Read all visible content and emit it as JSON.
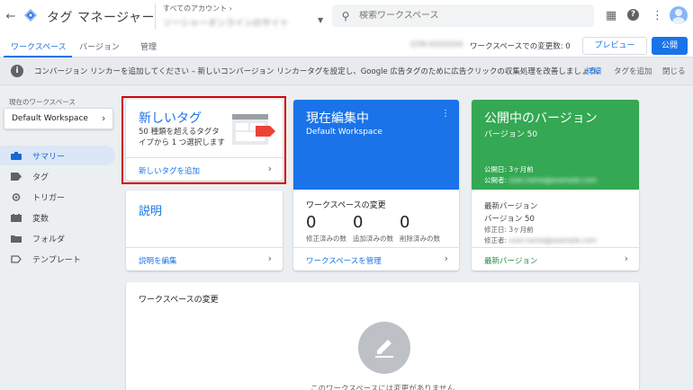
{
  "header": {
    "app_title": "タグ マネージャー",
    "account_label": "すべてのアカウント ›",
    "container_name": "ソーシャーオンラインのサイト",
    "search_placeholder": "検索ワークスペース"
  },
  "tabs": [
    {
      "label": "ワークスペース",
      "active": true
    },
    {
      "label": "バージョン",
      "active": false
    },
    {
      "label": "管理",
      "active": false
    }
  ],
  "toolbar": {
    "blurred_id": "GTM-XXXXXXX",
    "changes_text": "ワークスペースでの変更数: 0",
    "preview_label": "プレビュー",
    "publish_label": "公開"
  },
  "banner": {
    "text": "コンバージョン リンカーを追加してください – 新しいコンバージョン リンカータグを設定し、Google 広告タグのために広告クリックの収集処理を改善しましょう。",
    "link": "詳細",
    "add_tag": "タグを追加",
    "close": "閉じる"
  },
  "sidebar": {
    "workspace_label": "現在のワークスペース",
    "workspace_name": "Default Workspace",
    "items": [
      {
        "label": "サマリー",
        "active": true,
        "icon": "briefcase-icon"
      },
      {
        "label": "タグ",
        "active": false,
        "icon": "tag-icon"
      },
      {
        "label": "トリガー",
        "active": false,
        "icon": "trigger-icon"
      },
      {
        "label": "変数",
        "active": false,
        "icon": "variables-icon"
      },
      {
        "label": "フォルダ",
        "active": false,
        "icon": "folder-icon"
      },
      {
        "label": "テンプレート",
        "active": false,
        "icon": "template-icon"
      }
    ]
  },
  "new_tag": {
    "title": "新しいタグ",
    "description": "50 種類を超えるタグタイプから 1 つ選択します",
    "link": "新しいタグを追加"
  },
  "editing": {
    "title": "現在編集中",
    "workspace": "Default Workspace",
    "changes_title": "ワークスペースの変更",
    "counts": [
      {
        "value": "0",
        "label": "修正済みの数"
      },
      {
        "value": "0",
        "label": "追加済みの数"
      },
      {
        "value": "0",
        "label": "削除済みの数"
      }
    ],
    "link": "ワークスペースを管理"
  },
  "published": {
    "title": "公開中のバージョン",
    "version": "バージョン 50",
    "published_date": "公開日: 3ヶ月前",
    "publisher_label": "公開者:",
    "publisher_blur": "user.name@example.com",
    "latest_title": "最新バージョン",
    "latest_version": "バージョン 50",
    "modified_date": "修正日: 3ヶ月前",
    "modifier_label": "修正者:",
    "modifier_blur": "user.name@example.com",
    "link": "最新バージョン"
  },
  "description_card": {
    "title": "説明",
    "link": "説明を編集"
  },
  "workspace_changes": {
    "title": "ワークスペースの変更",
    "empty_text": "このワークスペースには変更がありません"
  },
  "colors": {
    "accent_blue": "#1a73e8",
    "published_green": "#34a853",
    "highlight_red": "#d50000"
  }
}
